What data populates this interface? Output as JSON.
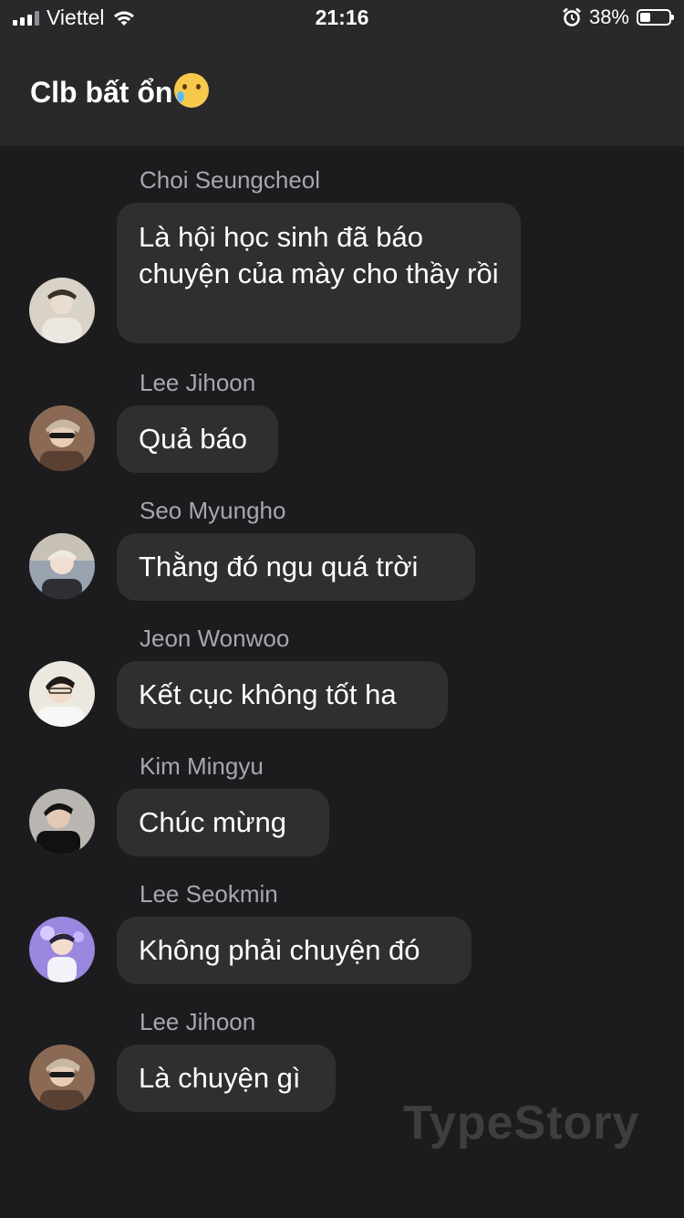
{
  "status_bar": {
    "carrier": "Viettel",
    "time": "21:16",
    "battery_percent": "38%",
    "battery_level": 0.38
  },
  "header": {
    "title": "Clb bất ổn"
  },
  "messages": [
    {
      "sender": "Choi Seungcheol",
      "text": "Là hội học sinh đã báo chuyện của mày cho thầy rồi",
      "avatar_color": "#cfc8bd"
    },
    {
      "sender": "Lee Jihoon",
      "text": "Quả báo",
      "avatar_color": "#6b4e3d"
    },
    {
      "sender": "Seo Myungho",
      "text": "Thằng đó ngu quá trời",
      "avatar_color": "#8c8e96"
    },
    {
      "sender": "Jeon Wonwoo",
      "text": "Kết cục không tốt ha",
      "avatar_color": "#e6e2da"
    },
    {
      "sender": "Kim Mingyu",
      "text": "Chúc mừng",
      "avatar_color": "#3c3c3c"
    },
    {
      "sender": "Lee Seokmin",
      "text": "Không phải chuyện đó",
      "avatar_color": "#8b6fd6"
    },
    {
      "sender": "Lee Jihoon",
      "text": "Là chuyện gì",
      "avatar_color": "#6b4e3d"
    }
  ],
  "watermark": "TypeStory"
}
